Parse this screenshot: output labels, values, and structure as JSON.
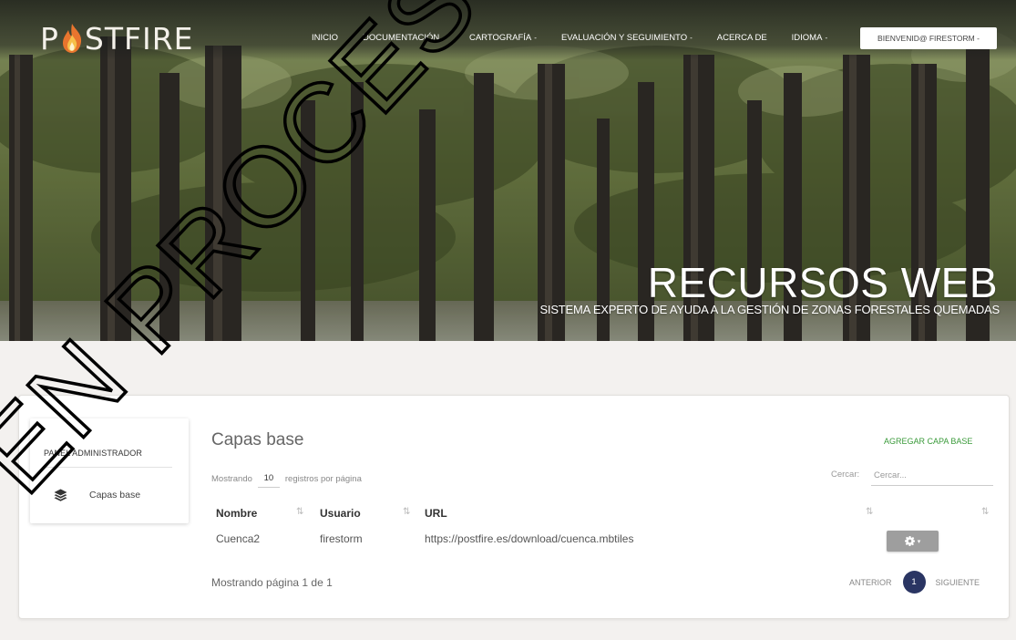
{
  "app": {
    "logo_text_before": "P",
    "logo_text_after": "STFIRE"
  },
  "nav": {
    "items": [
      {
        "label": "INICIO",
        "has_caret": false
      },
      {
        "label": "DOCUMENTACIÓN",
        "has_caret": true
      },
      {
        "label": "CARTOGRAFÍA",
        "has_caret": true
      },
      {
        "label": "EVALUACIÓN Y SEGUIMIENTO",
        "has_caret": true
      },
      {
        "label": "ACERCA DE",
        "has_caret": false
      },
      {
        "label": "IDIOMA",
        "has_caret": true
      }
    ],
    "caret": "-",
    "welcome_label": "BIENVENID@ FIRESTORM -"
  },
  "hero": {
    "title": "RECURSOS WEB",
    "subtitle": "SISTEMA EXPERTO DE AYUDA A LA GESTIÓN DE ZONAS FORESTALES QUEMADAS"
  },
  "watermark_text": "EN PROCESO AC",
  "sidebar": {
    "title": "PANEL ADMINISTRADOR",
    "items": [
      {
        "label": "Capas base",
        "icon": "layers-icon"
      }
    ]
  },
  "main": {
    "title": "Capas base",
    "add_label": "AGREGAR CAPA BASE",
    "show_prefix": "Mostrando",
    "page_length": "10",
    "show_suffix": "registros por página",
    "search_label": "Cercar:",
    "search_placeholder": "Cercar...",
    "sort_glyph": "⇅",
    "table": {
      "headers": [
        "Nombre",
        "Usuario",
        "URL"
      ],
      "rows": [
        {
          "nombre": "Cuenca2",
          "usuario": "firestorm",
          "url": "https://postfire.es/download/cuenca.mbtiles"
        }
      ]
    },
    "action_caret": "▾",
    "page_info": "Mostrando página 1 de 1",
    "pagination": {
      "prev": "ANTERIOR",
      "current": "1",
      "next": "SIGUIENTE"
    }
  },
  "colors": {
    "accent_green": "#3a9a3a",
    "pager_active": "#2a3563",
    "action_button": "#9e9e9e",
    "flame_orange": "#e8752e"
  }
}
